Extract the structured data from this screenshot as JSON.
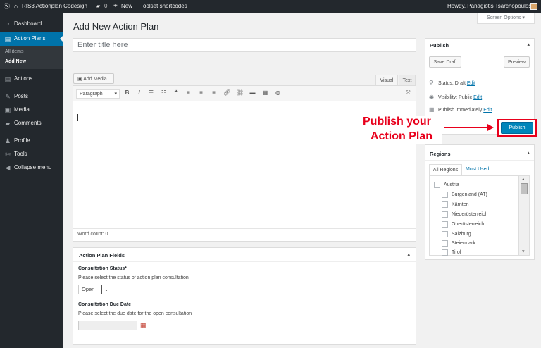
{
  "adminbar": {
    "site_name": "RIS3 Actionplan Codesign",
    "comment_count": "0",
    "new_label": "New",
    "toolset_label": "Toolset shortcodes",
    "howdy": "Howdy, Panagiotis Tsarchopoulos"
  },
  "sidebar": {
    "items": [
      {
        "label": "Dashboard",
        "icon": "dashboard-icon"
      },
      {
        "label": "Action Plans",
        "icon": "action-plans-icon"
      },
      {
        "label": "Actions",
        "icon": "actions-icon"
      },
      {
        "label": "Posts",
        "icon": "posts-icon"
      },
      {
        "label": "Media",
        "icon": "media-icon"
      },
      {
        "label": "Comments",
        "icon": "comments-icon"
      },
      {
        "label": "Profile",
        "icon": "profile-icon"
      },
      {
        "label": "Tools",
        "icon": "tools-icon"
      },
      {
        "label": "Collapse menu",
        "icon": "collapse-icon"
      }
    ],
    "submenu": [
      "All items",
      "Add New"
    ]
  },
  "screen_options": "Screen Options",
  "page_title": "Add New Action Plan",
  "title_placeholder": "Enter title here",
  "editor": {
    "add_media": "Add Media",
    "tab_visual": "Visual",
    "tab_text": "Text",
    "format_select": "Paragraph",
    "word_count": "Word count: 0"
  },
  "fields_box": {
    "title": "Action Plan Fields",
    "status_label": "Consultation Status*",
    "status_desc": "Please select the status of action plan consultation",
    "status_value": "Open",
    "date_label": "Consultation Due Date",
    "date_desc": "Please select the due date for the open consultation"
  },
  "publish_box": {
    "title": "Publish",
    "save_draft": "Save Draft",
    "preview": "Preview",
    "status_text": "Status: Draft",
    "visibility_text": "Visibility: Public",
    "schedule_text": "Publish immediately",
    "edit": "Edit",
    "publish_button": "Publish"
  },
  "annotation": {
    "line1": "Publish your",
    "line2": "Action Plan",
    "color": "#e8001c"
  },
  "regions_box": {
    "title": "Regions",
    "tab_all": "All Regions",
    "tab_most": "Most Used",
    "items": [
      "Austria",
      "Burgenland (AT)",
      "Kärnten",
      "Niederösterreich",
      "Oberösterreich",
      "Salzburg",
      "Steiermark",
      "Tirol"
    ]
  },
  "colors": {
    "accent": "#0073aa",
    "adminbar": "#23282d"
  }
}
